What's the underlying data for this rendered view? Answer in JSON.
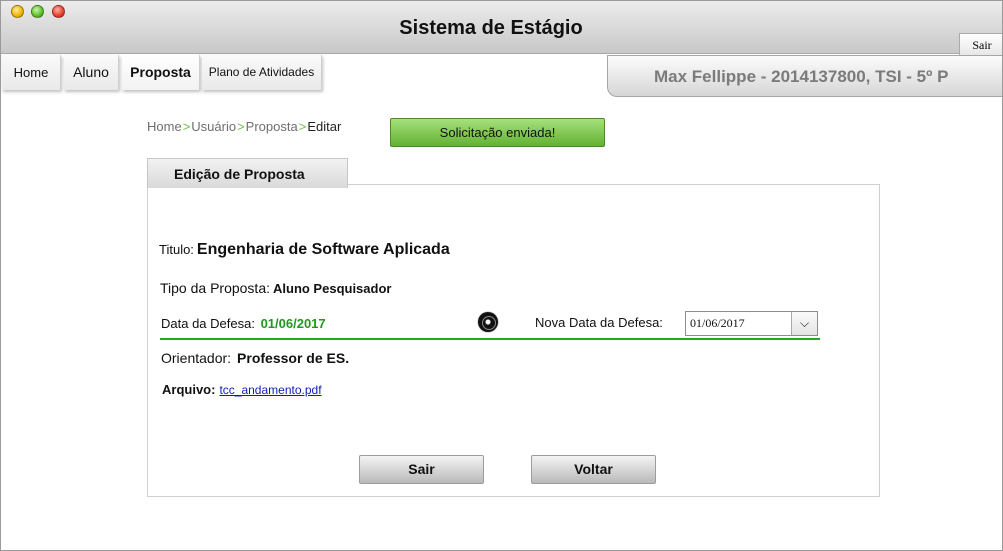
{
  "window": {
    "title": "Sistema de Estágio"
  },
  "header": {
    "logout_label": "Sair"
  },
  "nav": {
    "tabs": [
      {
        "label": "Home"
      },
      {
        "label": "Aluno"
      },
      {
        "label": "Proposta",
        "active": true
      },
      {
        "label": "Plano de Atividades"
      }
    ]
  },
  "user": {
    "display": "Max Fellippe - 2014137800, TSI - 5º P"
  },
  "breadcrumb": {
    "items": [
      "Home",
      "Usuário",
      "Proposta",
      "Editar"
    ],
    "separator": ">"
  },
  "status": {
    "message": "Solicitação enviada!",
    "color": "#62b232"
  },
  "panel": {
    "title": "Edição de Proposta"
  },
  "form": {
    "titulo": {
      "label": "Titulo:",
      "value": "Engenharia de Software Aplicada"
    },
    "tipo": {
      "label": "Tipo da Proposta:",
      "value": "Aluno Pesquisador"
    },
    "data_defesa": {
      "label": "Data da Defesa:",
      "value": "01/06/2017",
      "color": "#1d9a1d"
    },
    "nova_data": {
      "label": "Nova Data da Defesa:",
      "selected": "01/06/2017"
    },
    "orientador": {
      "label": "Orientador:",
      "value": "Professor de ES."
    },
    "arquivo": {
      "label": "Arquivo:",
      "link": "tcc_andamento.pdf"
    }
  },
  "actions": {
    "sair": "Sair",
    "voltar": "Voltar"
  },
  "icons": {
    "radio": "radio-selected-icon",
    "dropdown": "chevron-down-icon"
  }
}
